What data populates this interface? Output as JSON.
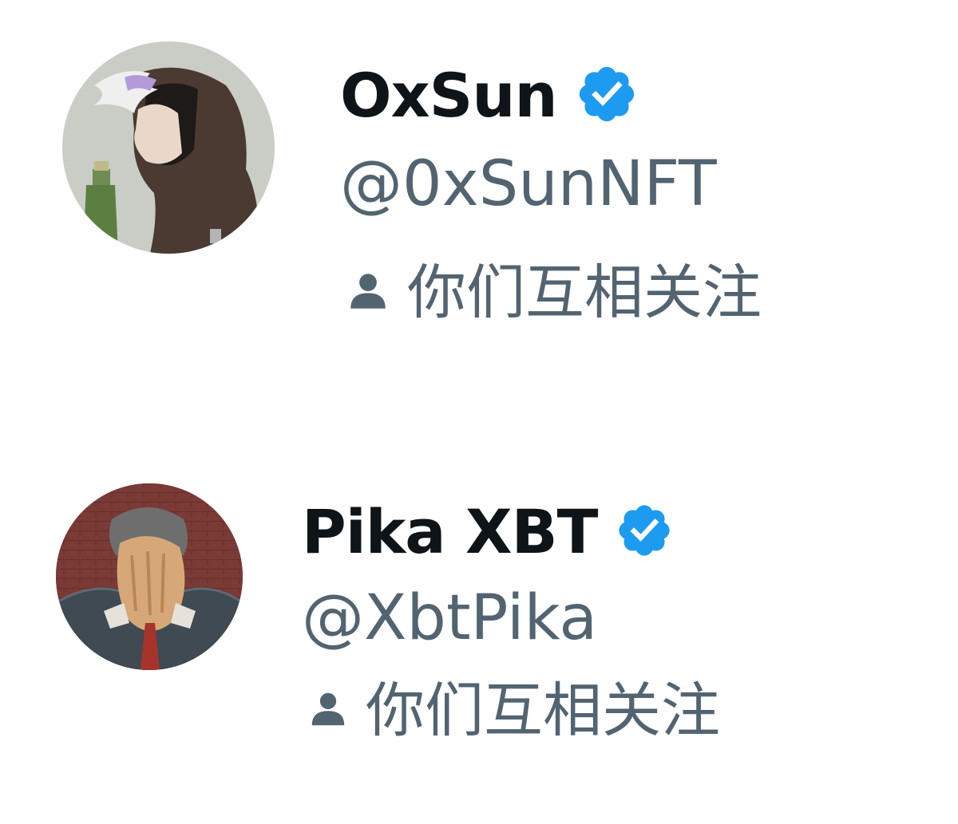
{
  "users": [
    {
      "display_name": "OxSun",
      "handle": "@0xSunNFT",
      "verified": true,
      "relationship": "你们互相关注",
      "avatar_icon": "hooded-character-avatar"
    },
    {
      "display_name": "Pika XBT",
      "handle": "@XbtPika",
      "verified": true,
      "relationship": "你们互相关注",
      "avatar_icon": "face-in-hands-avatar"
    }
  ],
  "colors": {
    "name": "#0f1419",
    "secondary": "#536471",
    "verified_badge": "#1d9bf0"
  }
}
